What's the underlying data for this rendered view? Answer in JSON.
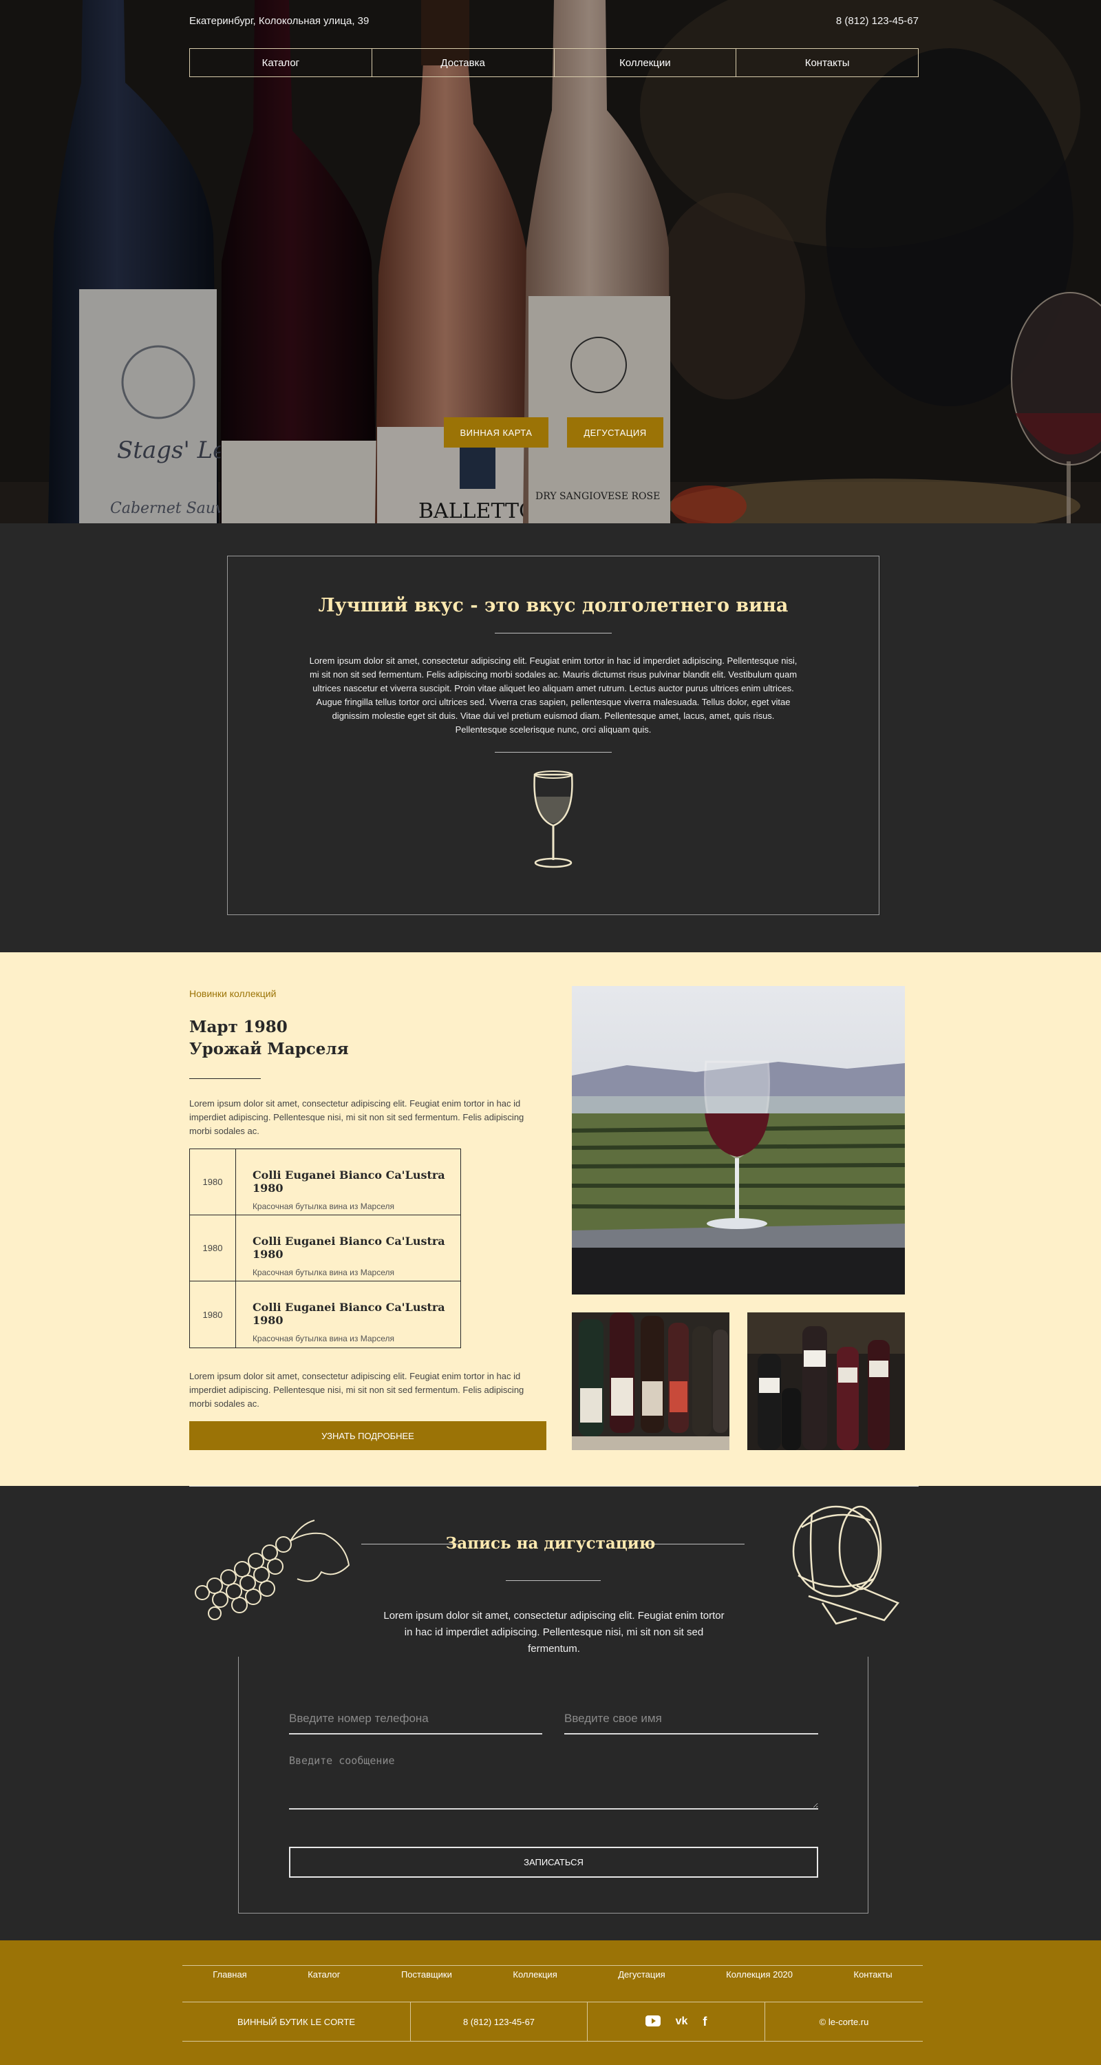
{
  "header": {
    "address": "Екатеринбург, Колокольная улица, 39",
    "phone": "8 (812) 123-45-67",
    "nav": [
      "Каталог",
      "Доставка",
      "Коллекции",
      "Контакты"
    ]
  },
  "hero": {
    "bottle_label": "BALLETTO",
    "bottle_label_2": "DRY SANGIOVESE ROSE",
    "bottle_label_3": "Stags' Leap",
    "bottle_label_4": "Cabernet Sauvignon",
    "btn_wine_card": "ВИННАЯ КАРТА",
    "btn_tasting": "ДЕГУСТАЦИЯ"
  },
  "intro": {
    "title": "Лучший вкус - это вкус долголетнего вина",
    "text": "Lorem ipsum dolor sit amet, consectetur adipiscing elit. Feugiat enim tortor in hac id imperdiet adipiscing. Pellentesque nisi, mi sit non sit sed fermentum. Felis adipiscing morbi sodales ac. Mauris dictumst risus pulvinar blandit elit. Vestibulum quam ultrices nascetur et viverra suscipit. Proin vitae aliquet leo aliquam amet rutrum. Lectus auctor purus ultrices enim ultrices. Augue fringilla tellus tortor orci ultrices sed. Viverra cras sapien, pellentesque viverra malesuada. Tellus dolor, eget vitae dignissim molestie eget sit duis. Vitae dui vel pretium euismod diam. Pellentesque amet, lacus, amet, quis risus. Pellentesque scelerisque nunc, orci aliquam quis."
  },
  "collection": {
    "kicker": "Новинки коллекций",
    "title_line1": "Март 1980",
    "title_line2": "Урожай Марселя",
    "text1": "Lorem ipsum dolor sit amet, consectetur adipiscing elit. Feugiat enim tortor in hac id imperdiet adipiscing. Pellentesque nisi, mi sit non sit sed fermentum. Felis adipiscing morbi sodales ac.",
    "wines": [
      {
        "year": "1980",
        "name": "Colli Euganei Bianco Ca'Lustra 1980",
        "desc": "Красочная бутылка вина из Марселя"
      },
      {
        "year": "1980",
        "name": "Colli Euganei Bianco Ca'Lustra 1980",
        "desc": "Красочная бутылка вина из Марселя"
      },
      {
        "year": "1980",
        "name": "Colli Euganei Bianco Ca'Lustra 1980",
        "desc": "Красочная бутылка вина из Марселя"
      }
    ],
    "text2": "Lorem ipsum dolor sit amet, consectetur adipiscing elit. Feugiat enim tortor in hac id imperdiet adipiscing. Pellentesque nisi, mi sit non sit sed fermentum. Felis adipiscing morbi sodales ac.",
    "button": "УЗНАТЬ ПОДРОБНЕЕ"
  },
  "tasting": {
    "title": "Запись на дигустацию",
    "text": "Lorem ipsum dolor sit amet, consectetur adipiscing elit. Feugiat enim tortor in hac id imperdiet adipiscing. Pellentesque nisi, mi sit non sit sed fermentum.",
    "phone_placeholder": "Введите номер телефона",
    "name_placeholder": "Введите свое имя",
    "message_placeholder": "Введите сообщение",
    "submit": "ЗАПИСАТЬСЯ"
  },
  "footer": {
    "links": [
      "Главная",
      "Каталог",
      "Поставщики",
      "Коллекция",
      "Дегустация",
      "Коллекция 2020",
      "Контакты"
    ],
    "brand": "ВИННЫЙ БУТИК LE CORTE",
    "phone": "8 (812) 123-45-67",
    "social_icons": [
      "youtube-icon",
      "vk-icon",
      "facebook-icon"
    ],
    "vk_text": "vk",
    "fb_text": "f",
    "copyright": "© le-corte.ru"
  },
  "colors": {
    "accent": "#9b7306",
    "dark": "#282828",
    "cream": "#fef0c9",
    "title": "#fde9b0"
  }
}
